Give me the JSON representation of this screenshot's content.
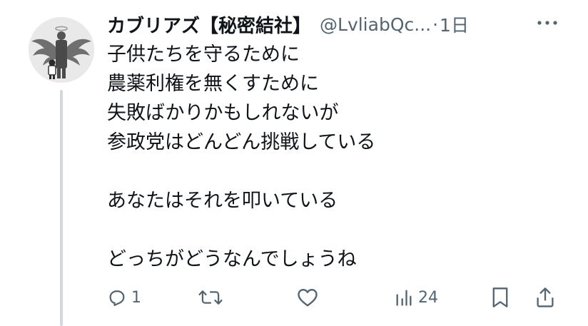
{
  "post": {
    "author": {
      "display_name": "カブリアズ【秘密結社】",
      "handle": "@LvliabQc...",
      "separator": "·",
      "time": "1日"
    },
    "body_lines": [
      "子供たちを守るために",
      "農薬利権を無くすために",
      "失敗ばかりかもしれないが",
      "参政党はどんどん挑戦している",
      "",
      "あなたはそれを叩いている",
      "",
      "どっちがどうなんでしょうね"
    ],
    "actions": {
      "reply_count": "1",
      "repost_count": "",
      "like_count": "",
      "views_count": "24"
    },
    "icons": {
      "more": "more-horizontal-icon",
      "reply": "reply-icon",
      "repost": "repost-icon",
      "like": "heart-icon",
      "views": "views-icon",
      "bookmark": "bookmark-icon",
      "share": "share-icon"
    }
  },
  "colors": {
    "text_primary": "#0f1419",
    "text_secondary": "#536471",
    "thread_line": "#cfd9de",
    "avatar_bg": "#e9e9e9"
  }
}
